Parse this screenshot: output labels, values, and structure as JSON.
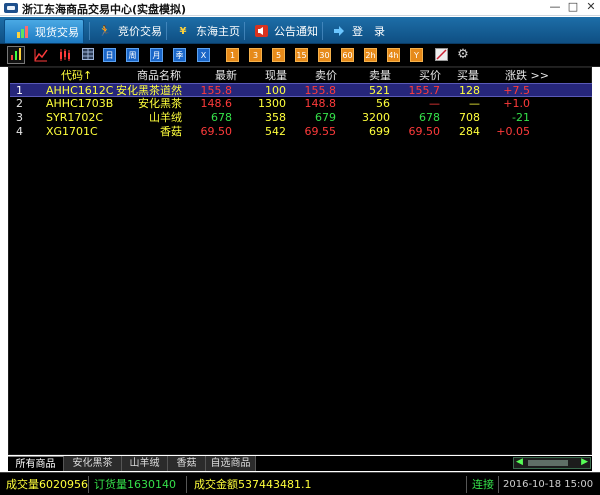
{
  "window": {
    "title": "浙江东海商品交易中心(实盘模拟)",
    "minimize": "—",
    "maximize": "□",
    "close": "✕"
  },
  "nav": {
    "tabs": [
      {
        "label": "现货交易",
        "icon": "bar-chart-icon",
        "active": true
      },
      {
        "label": "竞价交易",
        "icon": "runner-icon",
        "active": false
      },
      {
        "label": "东海主页",
        "icon": "yen-icon",
        "active": false
      },
      {
        "label": "公告通知",
        "icon": "speaker-icon",
        "active": false
      },
      {
        "label": "登　录",
        "icon": "arrow-right-icon",
        "active": false
      }
    ]
  },
  "toolbar": {
    "buttons": [
      {
        "name": "bar-chart-tool-icon",
        "text": "📊",
        "style": "plain"
      },
      {
        "name": "line-chart-tool-icon",
        "text": "📈",
        "style": "plain"
      },
      {
        "name": "candlestick-tool-icon",
        "text": "卍",
        "style": "plain"
      },
      {
        "name": "table-tool-icon",
        "text": "▦",
        "style": "plain"
      },
      {
        "name": "day-period-button",
        "text": "日",
        "style": "blue"
      },
      {
        "name": "week-period-button",
        "text": "周",
        "style": "blue"
      },
      {
        "name": "month-period-button",
        "text": "月",
        "style": "blue"
      },
      {
        "name": "season-period-button",
        "text": "季",
        "style": "blue"
      },
      {
        "name": "year-period-button",
        "text": "X",
        "style": "blue"
      },
      {
        "name": "min1-period-button",
        "text": "1",
        "style": "orange"
      },
      {
        "name": "min3-period-button",
        "text": "3",
        "style": "orange"
      },
      {
        "name": "min5-period-button",
        "text": "5",
        "style": "orange"
      },
      {
        "name": "min15-period-button",
        "text": "15",
        "style": "orange"
      },
      {
        "name": "min30-period-button",
        "text": "30",
        "style": "orange"
      },
      {
        "name": "min60-period-button",
        "text": "60",
        "style": "orange"
      },
      {
        "name": "hour2-period-button",
        "text": "2h",
        "style": "orange"
      },
      {
        "name": "hour4-period-button",
        "text": "4h",
        "style": "orange"
      },
      {
        "name": "custom-period-button",
        "text": "Y",
        "style": "orange"
      },
      {
        "name": "draw-tool-icon",
        "text": "⟋",
        "style": "plain"
      },
      {
        "name": "settings-gear-icon",
        "text": "⚙",
        "style": "plain"
      }
    ]
  },
  "table": {
    "headers": {
      "code": "代码↑",
      "name": "商品名称",
      "latest": "最新",
      "volume": "现量",
      "ask": "卖价",
      "ask_qty": "卖量",
      "bid": "买价",
      "bid_qty": "买量",
      "change": "涨跌 >>"
    },
    "rows": [
      {
        "idx": "1",
        "code": "AHHC1612C",
        "name": "安化黑茶道然",
        "latest": "155.8",
        "volume": "100",
        "ask": "155.8",
        "ask_qty": "521",
        "bid": "155.7",
        "bid_qty": "128",
        "change": "+7.5",
        "trend": "up",
        "selected": true
      },
      {
        "idx": "2",
        "code": "AHHC1703B",
        "name": "安化黑茶",
        "latest": "148.6",
        "volume": "1300",
        "ask": "148.8",
        "ask_qty": "56",
        "bid": "—",
        "bid_qty": "—",
        "change": "+1.0",
        "trend": "up",
        "selected": false
      },
      {
        "idx": "3",
        "code": "SYR1702C",
        "name": "山羊绒",
        "latest": "678",
        "volume": "358",
        "ask": "679",
        "ask_qty": "3200",
        "bid": "678",
        "bid_qty": "708",
        "change": "-21",
        "trend": "down",
        "selected": false
      },
      {
        "idx": "4",
        "code": "XG1701C",
        "name": "香菇",
        "latest": "69.50",
        "volume": "542",
        "ask": "69.55",
        "ask_qty": "699",
        "bid": "69.50",
        "bid_qty": "284",
        "change": "+0.05",
        "trend": "up",
        "selected": false
      }
    ]
  },
  "bottom_tabs": [
    {
      "label": "所有商品",
      "active": true
    },
    {
      "label": "安化黑茶",
      "active": false
    },
    {
      "label": "山羊绒",
      "active": false
    },
    {
      "label": "香菇",
      "active": false
    },
    {
      "label": "自选商品",
      "active": false
    }
  ],
  "status": {
    "volume": "成交量6020956",
    "orders": "订货量1630140",
    "amount": "成交金额537443481.1",
    "connection": "连接",
    "datetime": "2016-10-18 15:00"
  },
  "colors": {
    "up": "#ff3b3b",
    "down": "#35e04a",
    "code": "#ffff3c",
    "name": "#ffff3c",
    "selected_row": "#26267a",
    "nav_bg": "#1d6ea8"
  }
}
